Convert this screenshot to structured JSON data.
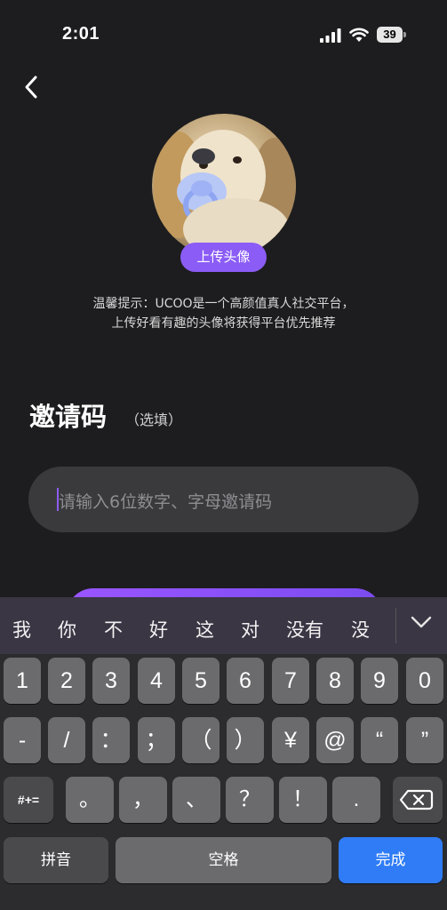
{
  "status_bar": {
    "time": "2:01",
    "battery": "39"
  },
  "profile": {
    "upload_label": "上传头像",
    "tip_line1": "温馨提示：UCOO是一个高颜值真人社交平台，",
    "tip_line2": "上传好看有趣的头像将获得平台优先推荐"
  },
  "invite": {
    "title": "邀请码",
    "optional": "（选填）",
    "placeholder": "请输入6位数字、字母邀请码"
  },
  "keyboard": {
    "candidates": [
      "我",
      "你",
      "不",
      "好",
      "这",
      "对",
      "没有",
      "没"
    ],
    "row1": [
      "1",
      "2",
      "3",
      "4",
      "5",
      "6",
      "7",
      "8",
      "9",
      "0"
    ],
    "row2": [
      "-",
      "/",
      "：",
      "；",
      "（",
      "）",
      "¥",
      "@",
      "“",
      "”"
    ],
    "row3_shift": "#+=",
    "row3": [
      "。",
      "，",
      "、",
      "？",
      "！",
      "."
    ],
    "pinyin": "拼音",
    "space": "空格",
    "done": "完成"
  },
  "colors": {
    "accent": "#8b5cf6",
    "done_key": "#2f7cf6",
    "background": "#1d1d1f"
  },
  "icons": [
    "signal-icon",
    "wifi-icon",
    "battery-icon",
    "back-arrow-icon",
    "chevron-down-icon",
    "backspace-icon"
  ]
}
